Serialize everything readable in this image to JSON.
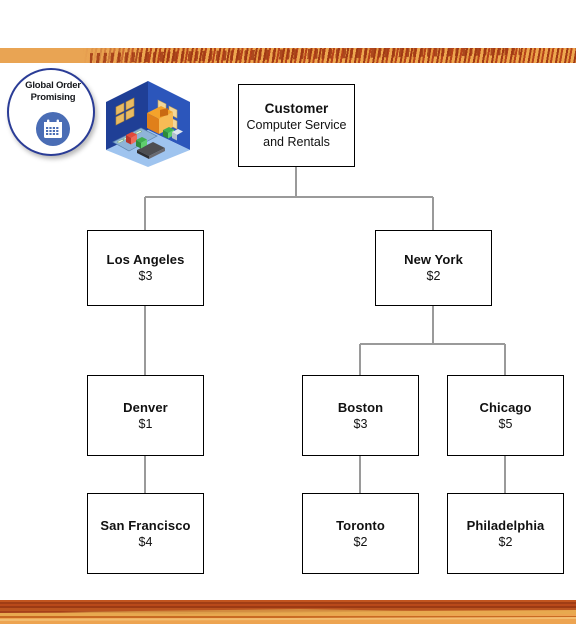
{
  "branding": {
    "badge_line1": "Global Order",
    "badge_line2": "Promising",
    "badge_icon": "calendar-icon",
    "badge_border_color": "#2a3c96",
    "badge_icon_color": "#4a6db5",
    "warehouse_icon": "isometric-warehouse-icon",
    "warehouse_wall_color": "#2c4ca8"
  },
  "decor": {
    "top_band": "wood-grain-band",
    "bottom_band": "wood-grain-band",
    "band_orange": "#e9a453",
    "band_brown": "#a33a14"
  },
  "diagram": {
    "type": "org-tree",
    "line_color": "#9a9a9a",
    "node_border_color": "#000000",
    "node_fill_color": "#ffffff",
    "nodes": [
      {
        "id": "customer",
        "title": "Customer",
        "sub": "Computer Service\nand Rentals",
        "sub_line1": "Computer  Service",
        "sub_line2": "and Rentals",
        "value": "",
        "level": 0
      },
      {
        "id": "los-angeles",
        "title": "Los Angeles",
        "value": "$3",
        "level": 1
      },
      {
        "id": "new-york",
        "title": "New York",
        "value": "$2",
        "level": 1
      },
      {
        "id": "denver",
        "title": "Denver",
        "value": "$1",
        "level": 2
      },
      {
        "id": "boston",
        "title": "Boston",
        "value": "$3",
        "level": 2
      },
      {
        "id": "chicago",
        "title": "Chicago",
        "value": "$5",
        "level": 2
      },
      {
        "id": "san-francisco",
        "title": "San Francisco",
        "value": "$4",
        "level": 3
      },
      {
        "id": "toronto",
        "title": "Toronto",
        "value": "$2",
        "level": 3
      },
      {
        "id": "philadelphia",
        "title": "Philadelphia",
        "value": "$2",
        "level": 3
      }
    ],
    "edges": [
      {
        "from": "customer",
        "to": "los-angeles"
      },
      {
        "from": "customer",
        "to": "new-york"
      },
      {
        "from": "los-angeles",
        "to": "denver"
      },
      {
        "from": "denver",
        "to": "san-francisco"
      },
      {
        "from": "new-york",
        "to": "boston"
      },
      {
        "from": "new-york",
        "to": "chicago"
      },
      {
        "from": "boston",
        "to": "toronto"
      },
      {
        "from": "chicago",
        "to": "philadelphia"
      }
    ]
  }
}
